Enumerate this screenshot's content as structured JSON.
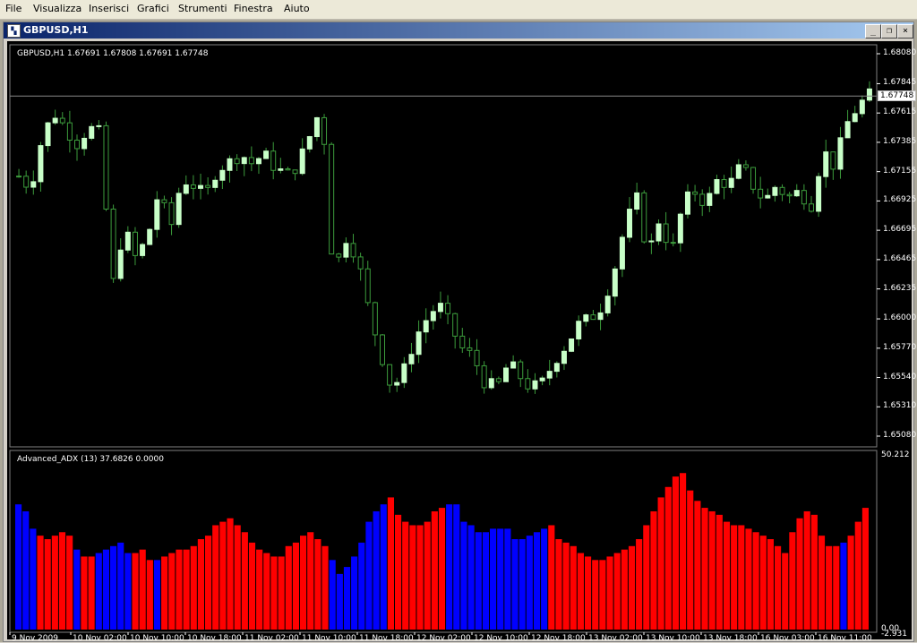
{
  "menu": [
    "File",
    "Visualizza",
    "Inserisci",
    "Grafici",
    "Strumenti",
    "Finestra",
    "Aiuto"
  ],
  "window": {
    "icon": "chart-window-icon",
    "title": "GBPUSD,H1",
    "buttons": [
      {
        "name": "minimize-button",
        "glyph": "_"
      },
      {
        "name": "restore-button",
        "glyph": "❐"
      },
      {
        "name": "close-button",
        "glyph": "×"
      }
    ]
  },
  "colors": {
    "bg": "#000000",
    "candle": "#c8ffc8",
    "wick": "#3c9c3c",
    "adx_up": "#ff0000",
    "adx_down": "#0000ff",
    "grid_line": "#808080"
  },
  "chart_data": [
    {
      "type": "candlestick",
      "title": "GBPUSD,H1 1.67691 1.67808 1.67691 1.67748",
      "symbol": "GBPUSD,H1",
      "ohlc_header": "1.67691 1.67808 1.67691 1.67748",
      "current_price": "1.67748",
      "ylim": [
        1.6508,
        1.6808
      ],
      "y_ticks": [
        "1.68080",
        "1.67845",
        "1.67615",
        "1.67385",
        "1.67155",
        "1.66925",
        "1.66695",
        "1.66465",
        "1.66235",
        "1.66000",
        "1.65770",
        "1.65540",
        "1.65310",
        "1.65080"
      ],
      "close_path": [
        1.6712,
        1.6703,
        1.6742,
        1.6762,
        1.675,
        1.6738,
        1.675,
        1.6745,
        1.6623,
        1.6672,
        1.6648,
        1.6662,
        1.67,
        1.667,
        1.671,
        1.6705,
        1.6695,
        1.6718,
        1.6722,
        1.673,
        1.6722,
        1.6729,
        1.6719,
        1.6712,
        1.6722,
        1.6744,
        1.6768,
        1.6632,
        1.6665,
        1.665,
        1.6608,
        1.6575,
        1.6545,
        1.6558,
        1.6585,
        1.66,
        1.6612,
        1.6595,
        1.6577,
        1.657,
        1.655,
        1.6545,
        1.6565,
        1.6555,
        1.6545,
        1.655,
        1.6568,
        1.658,
        1.6595,
        1.66,
        1.661,
        1.6635,
        1.6672,
        1.6695,
        1.665,
        1.668,
        1.665,
        1.669,
        1.67,
        1.669,
        1.671,
        1.6705,
        1.672,
        1.6705,
        1.6692,
        1.6705,
        1.6695,
        1.67,
        1.669,
        1.6732,
        1.672,
        1.6752,
        1.6767,
        1.6775
      ],
      "x_ticks": [
        "9 Nov 2009",
        "10 Nov 02:00",
        "10 Nov 10:00",
        "10 Nov 18:00",
        "11 Nov 02:00",
        "11 Nov 10:00",
        "11 Nov 18:00",
        "12 Nov 02:00",
        "12 Nov 10:00",
        "12 Nov 18:00",
        "13 Nov 02:00",
        "13 Nov 10:00",
        "13 Nov 18:00",
        "16 Nov 03:00",
        "16 Nov 11:00"
      ]
    },
    {
      "type": "bar",
      "title": "Advanced_ADX (13) 37.6826 0.0000",
      "ylim": [
        0,
        50.212
      ],
      "y_ticks": [
        "50.212",
        "0.00",
        "-2.931"
      ],
      "series": [
        {
          "values": [
            36,
            34,
            29,
            27,
            26,
            27,
            28,
            27,
            23,
            21,
            21,
            22,
            23,
            24,
            25,
            22,
            22,
            23,
            20,
            20,
            21,
            22,
            23,
            23,
            24,
            26,
            27,
            30,
            31,
            32,
            30,
            28,
            25,
            23,
            22,
            21,
            21,
            24,
            25,
            27,
            28,
            26,
            24,
            20,
            16,
            18,
            21,
            25,
            31,
            34,
            36,
            38,
            33,
            31,
            30,
            30,
            31,
            34,
            35,
            36,
            36,
            31,
            30,
            28,
            28,
            29,
            29,
            29,
            26,
            26,
            27,
            28,
            29,
            30,
            26,
            25,
            24,
            22,
            21,
            20,
            20,
            21,
            22,
            23,
            24,
            26,
            30,
            34,
            38,
            41,
            44,
            45,
            40,
            37,
            35,
            34,
            33,
            31,
            30,
            30,
            29,
            28,
            27,
            26,
            24,
            22,
            28,
            32,
            34,
            33,
            27,
            24,
            24,
            25,
            27,
            31,
            35
          ]
        },
        {
          "direction": "blue_runs_at",
          "indices": [
            0,
            1,
            2,
            8,
            11,
            12,
            13,
            14,
            15,
            19,
            43,
            44,
            45,
            46,
            47,
            48,
            49,
            50,
            59,
            60,
            61,
            62,
            63,
            64,
            65,
            66,
            67,
            68,
            69,
            70,
            71,
            72,
            113
          ]
        }
      ]
    }
  ]
}
